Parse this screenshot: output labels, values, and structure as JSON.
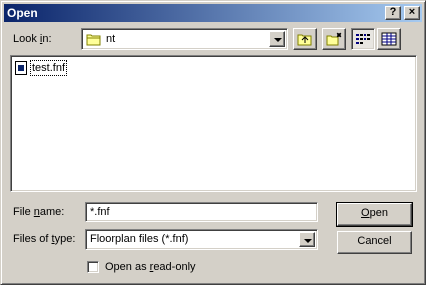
{
  "window": {
    "title": "Open"
  },
  "titlebar": {
    "help_glyph": "?",
    "close_glyph": "×"
  },
  "lookin": {
    "label_prefix": "Look ",
    "label_hot": "i",
    "label_suffix": "n:",
    "value": "nt"
  },
  "file_list": {
    "items": [
      {
        "name": "test.fnf",
        "icon": "document-icon"
      }
    ]
  },
  "filename": {
    "label_prefix": "File ",
    "label_hot": "n",
    "label_suffix": "ame:",
    "value": "*.fnf"
  },
  "filetype": {
    "label_prefix": "Files of ",
    "label_hot": "t",
    "label_suffix": "ype:",
    "value": "Floorplan files (*.fnf)"
  },
  "buttons": {
    "open_hot": "O",
    "open_rest": "pen",
    "cancel": "Cancel"
  },
  "readonly": {
    "label_prefix": "Open as ",
    "label_hot": "r",
    "label_suffix": "ead-only",
    "checked": false
  },
  "colors": {
    "title_start": "#0a246a",
    "title_end": "#a6caf0",
    "face": "#d4d0c8"
  }
}
